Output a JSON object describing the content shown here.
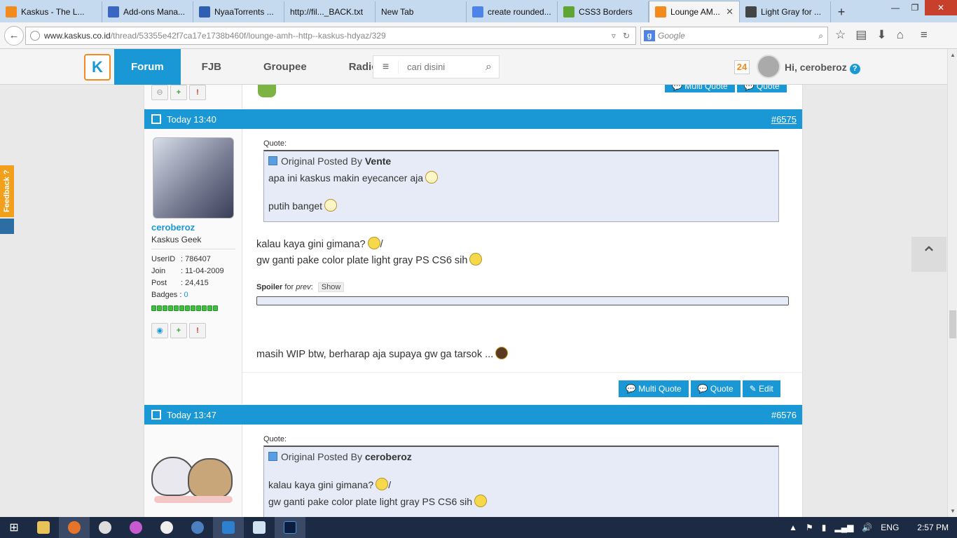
{
  "browser": {
    "tabs": [
      {
        "title": "Kaskus - The L...",
        "color": "#f28a1e"
      },
      {
        "title": "Add-ons Mana...",
        "color": "#3a66c4"
      },
      {
        "title": "NyaaTorrents ...",
        "color": "#2f5fb3"
      },
      {
        "title": "http://fil..._BACK.txt",
        "color": ""
      },
      {
        "title": "New Tab",
        "color": ""
      },
      {
        "title": "create rounded...",
        "color": "#4e84e8"
      },
      {
        "title": "CSS3 Borders",
        "color": "#5fa535"
      },
      {
        "title": "Lounge AM...",
        "color": "#f28a1e",
        "active": true
      },
      {
        "title": "Light Gray for ...",
        "color": "#444"
      }
    ],
    "newtab": "+",
    "url_domain": "www.kaskus.co.id",
    "url_path": "/thread/53355e42f7ca17e1738b460f/lounge-amh--http--kaskus-hdyaz/329",
    "search_placeholder": "Google"
  },
  "header": {
    "logo": "K",
    "nav": [
      "Forum",
      "FJB",
      "Groupee",
      "Radio"
    ],
    "search_placeholder": "cari disini",
    "notif_count": "24",
    "greeting": "Hi, ceroberoz"
  },
  "feedback_label": "Feedback ?",
  "post1": {
    "time": "Today 13:40",
    "number": "#6575",
    "username": "ceroberoz",
    "user_title": "Kaskus Geek",
    "userid_label": "UserID",
    "userid": ": 786407",
    "join_label": "Join",
    "join": ": 11-04-2009",
    "post_label": "Post",
    "post_count": ": 24,415",
    "badges_label": "Badges :",
    "badges": "0",
    "quote_label": "Quote:",
    "orig_prefix": "Original Posted By",
    "orig_author": "Vente",
    "quote_line1": "apa ini kaskus makin eyecancer aja",
    "quote_line2": "putih banget",
    "msg_line1": "kalau kaya gini gimana?",
    "msg_line1_suffix": "/",
    "msg_line2": "gw ganti pake color plate light gray PS CS6 sih",
    "spoiler_label": "Spoiler",
    "spoiler_for": "for",
    "spoiler_target": "prev",
    "spoiler_btn": "Show",
    "msg_line3": "masih WIP btw, berharap aja supaya gw ga tarsok ...",
    "btn_multiquote": "Multi Quote",
    "btn_quote": "Quote",
    "btn_edit": "Edit"
  },
  "post2": {
    "time": "Today 13:47",
    "number": "#6576",
    "quote_label": "Quote:",
    "orig_prefix": "Original Posted By",
    "orig_author": "ceroberoz",
    "quote_line1": "kalau kaya gini gimana?",
    "quote_line1_suffix": "/",
    "quote_line2": "gw ganti pake color plate light gray PS CS6 sih"
  },
  "prev_post_btns": {
    "multiquote": "Multi Quote",
    "quote": "Quote"
  },
  "taskbar": {
    "lang": "ENG",
    "time": "2:57 PM"
  }
}
